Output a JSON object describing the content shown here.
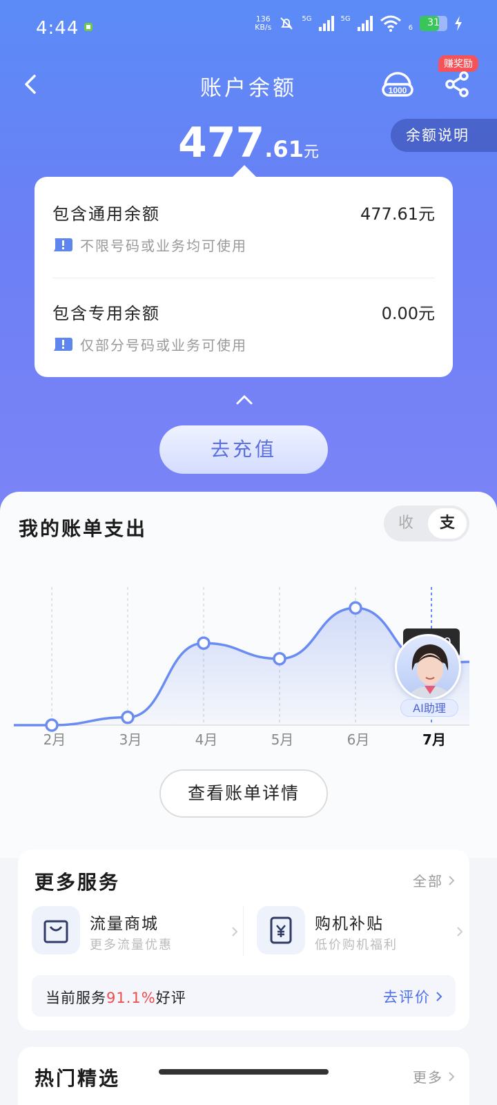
{
  "status_bar": {
    "time": "4:44",
    "net_speed_value": "136",
    "net_speed_unit": "KB/s",
    "signal1_label": "5G",
    "signal2_label": "5G",
    "wifi_label": "6",
    "battery": "31"
  },
  "header": {
    "title": "账户余额",
    "reward_badge": "赚奖励",
    "balance_int": "477",
    "balance_dec": ".61",
    "balance_unit": "元",
    "explain_label": "余额说明"
  },
  "balance_card": {
    "general_label": "包含通用余额",
    "general_value": "477.61元",
    "general_note": "不限号码或业务均可使用",
    "special_label": "包含专用余额",
    "special_value": "0.00元",
    "special_note": "仅部分号码或业务可使用"
  },
  "recharge_label": "去充值",
  "bill": {
    "title": "我的账单支出",
    "toggle_income": "收",
    "toggle_expense": "支",
    "detail_button": "查看账单详情",
    "tooltip_text": "9"
  },
  "chart_data": {
    "type": "area",
    "categories": [
      "2月",
      "3月",
      "4月",
      "5月",
      "6月",
      "7月"
    ],
    "values": [
      0,
      8,
      84,
      68,
      120,
      62
    ],
    "selected_index": 5,
    "ylim": [
      0,
      140
    ],
    "grid": "vertical dashed",
    "color": "#6a8cf0"
  },
  "ai_assistant": {
    "label": "AI助理"
  },
  "services": {
    "title": "更多服务",
    "all_label": "全部",
    "items": [
      {
        "name": "流量商城",
        "sub": "更多流量优惠",
        "icon": "bag-icon"
      },
      {
        "name": "购机补贴",
        "sub": "低价购机福利",
        "icon": "phone-yuan-icon"
      }
    ],
    "rating_prefix": "当前服务",
    "rating_pct": "91.1%",
    "rating_suffix": "好评",
    "rating_link": "去评价"
  },
  "hot": {
    "title": "热门精选",
    "more_label": "更多"
  },
  "colors": {
    "accent": "#5b6fe0",
    "link": "#4d6fe8",
    "highlight": "#f04b4b",
    "badge": "#f4535a"
  }
}
